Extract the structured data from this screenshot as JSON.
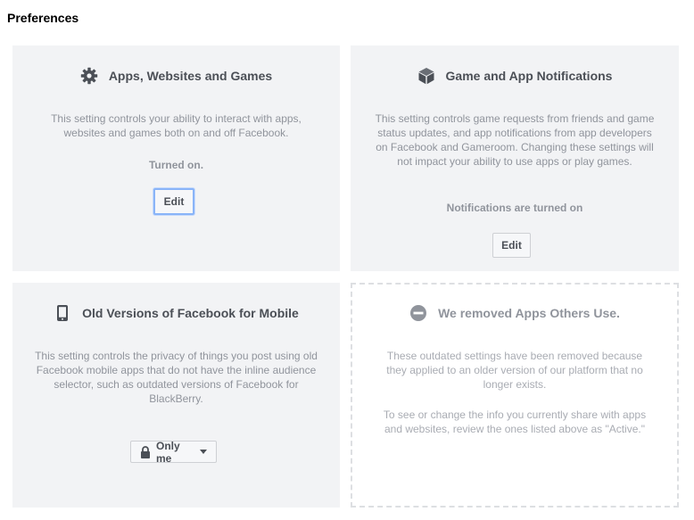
{
  "page": {
    "title": "Preferences"
  },
  "cards": {
    "apps": {
      "title": "Apps, Websites and Games",
      "icon": "gear-icon",
      "description": "This setting controls your ability to interact with apps, websites and games both on and off Facebook.",
      "status": "Turned on.",
      "button": "Edit"
    },
    "notifications": {
      "title": "Game and App Notifications",
      "icon": "cube-icon",
      "description": "This setting controls game requests from friends and game status updates, and app notifications from app developers on Facebook and Gameroom. Changing these settings will not impact your ability to use apps or play games.",
      "status": "Notifications are turned on",
      "button": "Edit"
    },
    "mobile": {
      "title": "Old Versions of Facebook for Mobile",
      "icon": "phone-icon",
      "description": "This setting controls the privacy of things you post using old Facebook mobile apps that do not have the inline audience selector, such as outdated versions of Facebook for BlackBerry.",
      "privacy_selector": {
        "label": "Only me",
        "icon": "lock-icon"
      }
    },
    "removed": {
      "title": "We removed Apps Others Use.",
      "icon": "minus-circle-icon",
      "description_1": "These outdated settings have been removed because they applied to an older version of our platform that no longer exists.",
      "description_2": "To see or change the info you currently share with apps and websites, review the ones listed above as \"Active.\""
    }
  },
  "colors": {
    "card_bg": "#f2f3f5",
    "title_text": "#4b4f56",
    "muted_text": "#90949c",
    "focus_ring": "#8ab4f8"
  }
}
